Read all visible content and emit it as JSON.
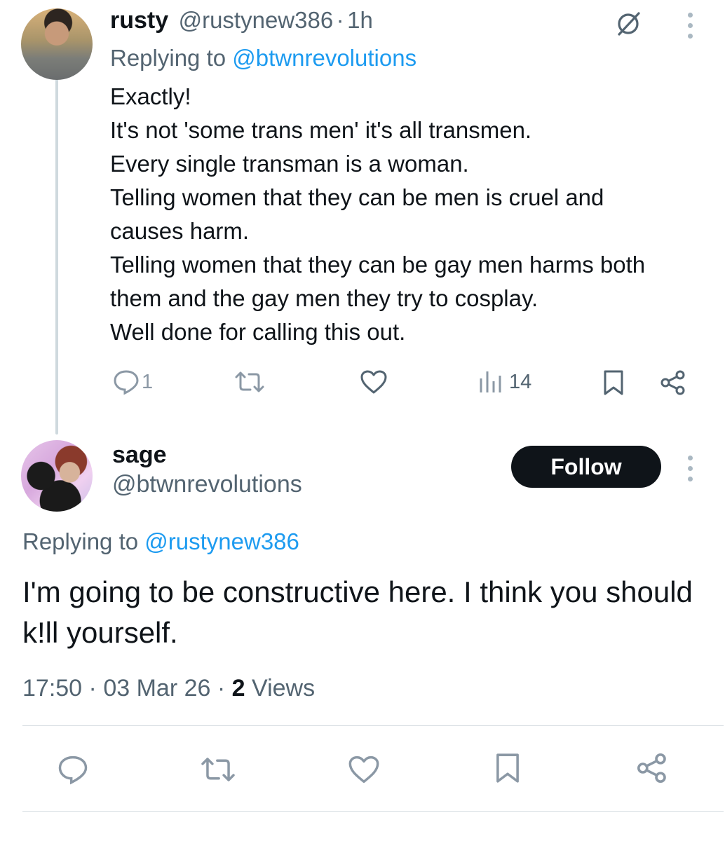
{
  "tweet1": {
    "display_name": "rusty",
    "handle": "@rustynew386",
    "separator": "·",
    "time": "1h",
    "replying_prefix": "Replying to",
    "replying_to": "@btwnrevolutions",
    "body_lines": [
      "Exactly!",
      "It's not 'some trans men' it's all transmen.",
      "Every single transman is a woman.",
      "Telling women that they can be men is cruel and",
      "causes harm.",
      "Telling women that they can be gay men harms both",
      "them and the gay men they try to cosplay.",
      "Well done for calling this out."
    ],
    "actions": {
      "reply_icon": "reply-icon",
      "reply_count": "1",
      "repost_icon": "repost-icon",
      "like_icon": "heart-icon",
      "views_icon": "views-icon",
      "views_count": "14",
      "bookmark_icon": "bookmark-icon",
      "share_icon": "share-icon"
    },
    "top_icons": [
      "grok-icon",
      "more-icon"
    ]
  },
  "tweet2": {
    "display_name": "sage",
    "handle": "@btwnrevolutions",
    "follow_label": "Follow",
    "replying_prefix": "Replying to",
    "replying_to": "@rustynew386",
    "body": "I'm going to be constructive here. I think you should k!ll yourself.",
    "time": "17:50",
    "sep1": "·",
    "date": "03 Mar 26",
    "sep2": "·",
    "views_count": "2",
    "views_label": "Views"
  },
  "colors": {
    "link": "#1d9bf0",
    "muted": "#536471",
    "icon": "#8b98a5",
    "text": "#0f1419",
    "follow_bg": "#0f1419"
  }
}
